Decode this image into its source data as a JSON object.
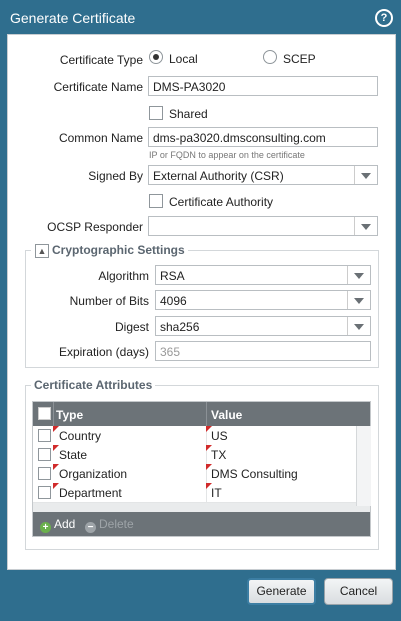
{
  "window": {
    "title": "Generate Certificate"
  },
  "form": {
    "cert_type_label": "Certificate Type",
    "cert_type_options": [
      "Local",
      "SCEP"
    ],
    "cert_type_selected": "Local",
    "cert_name_label": "Certificate Name",
    "cert_name_value": "DMS-PA3020",
    "shared_label": "Shared",
    "common_name_label": "Common Name",
    "common_name_value": "dms-pa3020.dmsconsulting.com",
    "common_name_hint": "IP or FQDN to appear on the certificate",
    "signed_by_label": "Signed By",
    "signed_by_value": "External Authority (CSR)",
    "cert_authority_label": "Certificate Authority",
    "ocsp_label": "OCSP Responder",
    "ocsp_value": ""
  },
  "crypto": {
    "legend": "Cryptographic Settings",
    "toggle_glyph": "▲",
    "algorithm_label": "Algorithm",
    "algorithm_value": "RSA",
    "bits_label": "Number of Bits",
    "bits_value": "4096",
    "digest_label": "Digest",
    "digest_value": "sha256",
    "expiration_label": "Expiration (days)",
    "expiration_placeholder": "365"
  },
  "attributes": {
    "legend": "Certificate Attributes",
    "columns": [
      "Type",
      "Value"
    ],
    "rows": [
      {
        "type": "Country",
        "value": "US"
      },
      {
        "type": "State",
        "value": "TX"
      },
      {
        "type": "Organization",
        "value": "DMS Consulting"
      },
      {
        "type": "Department",
        "value": "IT"
      }
    ],
    "add_label": "Add",
    "delete_label": "Delete"
  },
  "buttons": {
    "generate": "Generate",
    "cancel": "Cancel"
  },
  "colors": {
    "title_bar": "#2f6e8e",
    "add_icon": "#6ab04c",
    "grid_header": "#6c7378"
  }
}
